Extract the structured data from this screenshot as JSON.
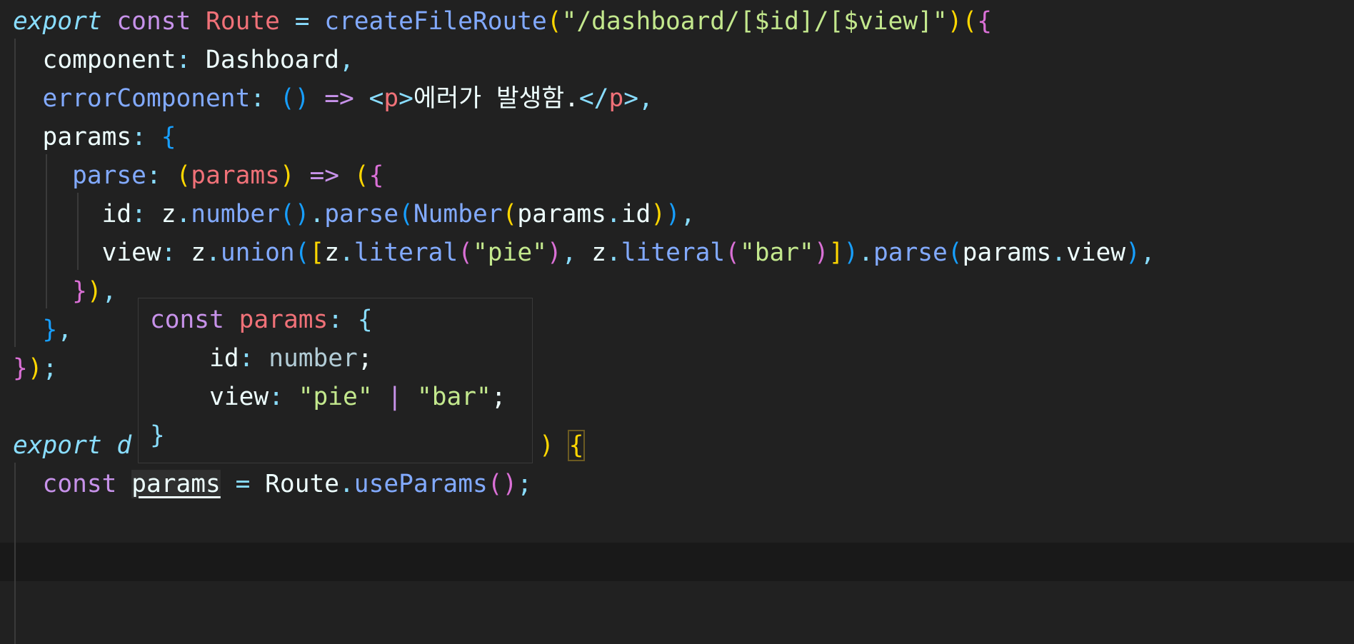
{
  "colors": {
    "background": "#212121",
    "current_line": "#191919",
    "keyword": "#c792ea",
    "string": "#c3e88d",
    "function": "#82aaff",
    "variable": "#f07178",
    "operator": "#89ddff",
    "bracket_1": "#ffd700",
    "bracket_2": "#da70d6",
    "bracket_3": "#179fff"
  },
  "code": {
    "l1": {
      "export": "export",
      "const": "const",
      "route": "Route",
      "eq": "=",
      "fn": "createFileRoute",
      "open1": "(",
      "path": "\"/dashboard/[$id]/[$view]\"",
      "close1": ")",
      "open2": "(",
      "brace": "{"
    },
    "l2": {
      "key": "component",
      "colon": ":",
      "value": "Dashboard",
      "comma": ","
    },
    "l3": {
      "key": "errorComponent",
      "colon": ":",
      "parens": "()",
      "arrow": "=>",
      "lt1": "<",
      "tag1": "p",
      "gt1": ">",
      "text": "에러가 발생함.",
      "lt2": "</",
      "tag2": "p",
      "gt2": ">",
      "comma": ","
    },
    "l4": {
      "key": "params",
      "colon": ":",
      "brace": "{"
    },
    "l5": {
      "key": "parse",
      "colon": ":",
      "open": "(",
      "param": "params",
      "close": ")",
      "arrow": "=>",
      "open2": "(",
      "brace": "{"
    },
    "l6": {
      "key": "id",
      "colon": ":",
      "z": "z",
      "dot1": ".",
      "number_fn": "number",
      "p1": "()",
      "dot2": ".",
      "parse_fn": "parse",
      "open": "(",
      "Number": "Number",
      "open2": "(",
      "params": "params",
      "dot3": ".",
      "prop": "id",
      "close2": ")",
      "close": ")",
      "comma": ","
    },
    "l7": {
      "key": "view",
      "colon": ":",
      "z": "z",
      "dot1": ".",
      "union": "union",
      "open": "(",
      "sq_open": "[",
      "z2": "z",
      "dot2": ".",
      "literal": "literal",
      "o2": "(",
      "pie": "\"pie\"",
      "c2": ")",
      "comma1": ",",
      "z3": "z",
      "dot3": ".",
      "literal2": "literal",
      "o3": "(",
      "bar": "\"bar\"",
      "c3": ")",
      "sq_close": "]",
      "close": ")",
      "dot4": ".",
      "parse": "parse",
      "o4": "(",
      "params": "params",
      "dot5": ".",
      "prop": "view",
      "c4": ")",
      "comma": ","
    },
    "l8": {
      "brace": "}",
      "paren": ")",
      "comma": ","
    },
    "l9": {
      "brace": "}",
      "comma": ","
    },
    "l10": {
      "brace": "}",
      "paren": ")",
      "semi": ";"
    },
    "l12": {
      "export": "export",
      "d": "d",
      "paren": ")",
      "brace": "{"
    },
    "l13": {
      "const": "const",
      "var": "params",
      "eq": "=",
      "route": "Route",
      "dot": ".",
      "fn": "useParams",
      "parens": "()",
      "semi": ";"
    }
  },
  "hover": {
    "l1": {
      "const": "const",
      "name": "params",
      "colon": ":",
      "brace": "{"
    },
    "l2": {
      "key": "id",
      "colon": ":",
      "type": "number",
      "semi": ";"
    },
    "l3": {
      "key": "view",
      "colon": ":",
      "pie": "\"pie\"",
      "bar_sep": "|",
      "bar": "\"bar\"",
      "semi": ";"
    },
    "l4": {
      "brace": "}"
    }
  }
}
